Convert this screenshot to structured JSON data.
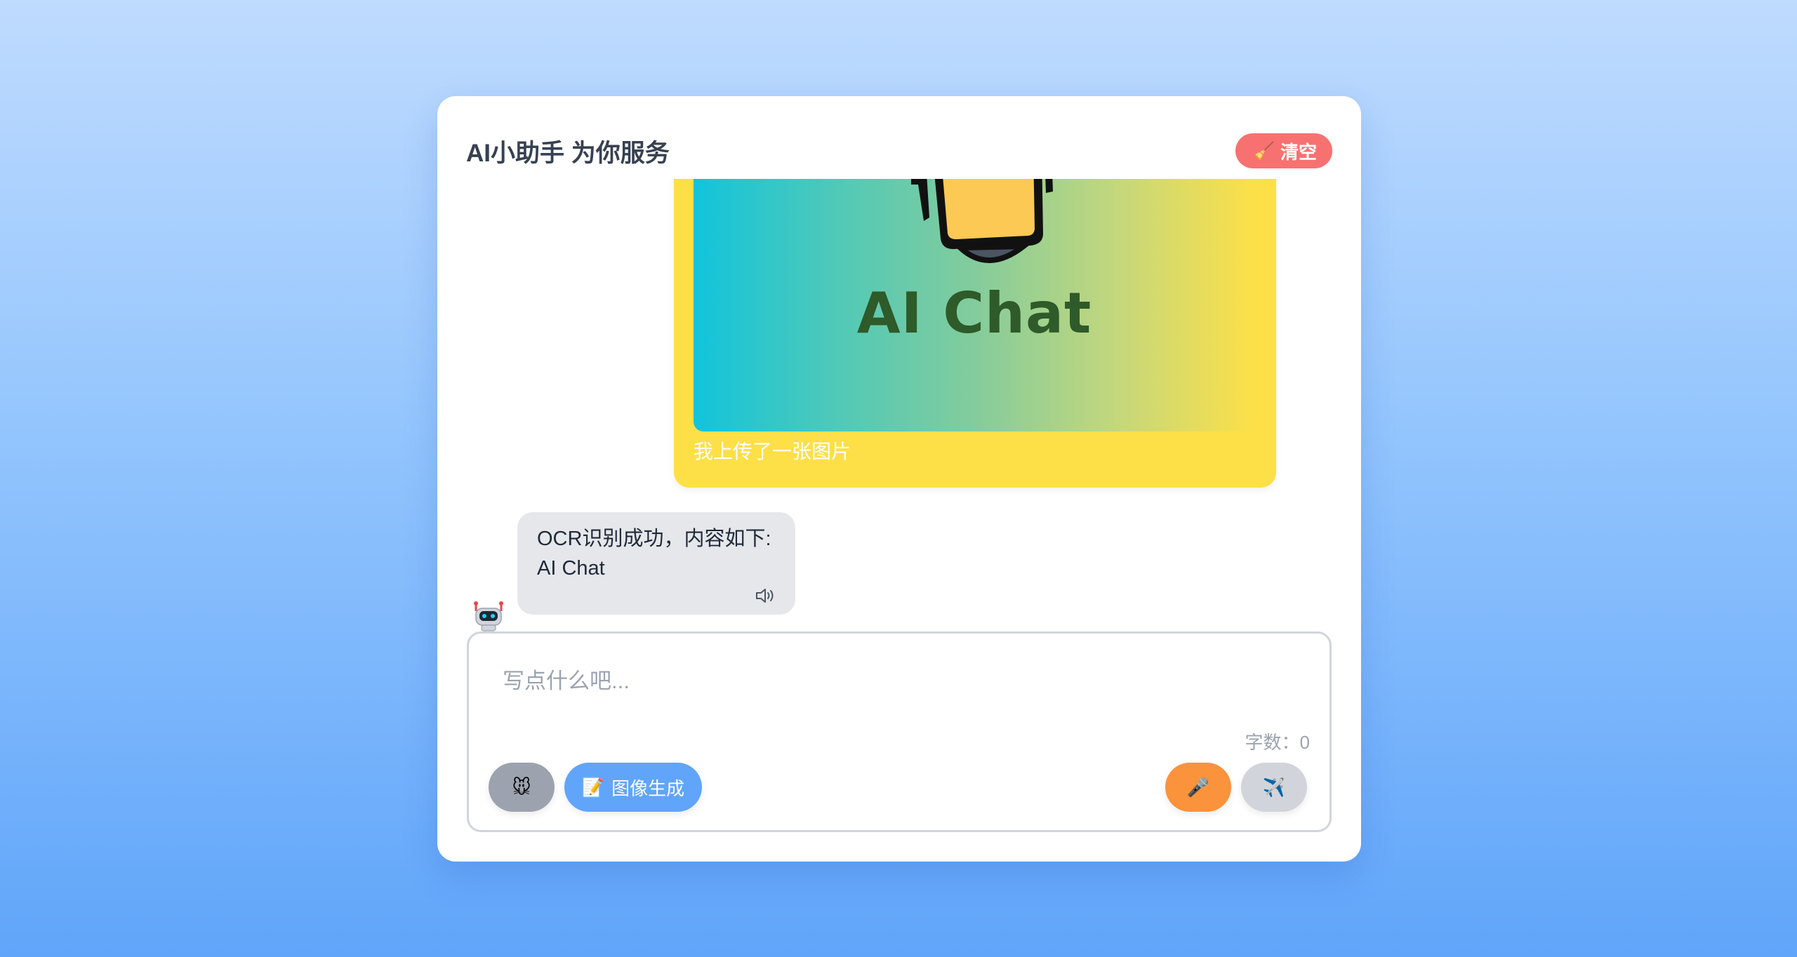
{
  "header": {
    "title": "AI小助手 为你服务",
    "clear_label": "清空",
    "clear_icon": "broom-icon"
  },
  "messages": {
    "user": {
      "image_text": "AI Chat",
      "caption": "我上传了一张图片"
    },
    "bot": {
      "line1": "OCR识别成功，内容如下:",
      "line2": "AI Chat"
    }
  },
  "input": {
    "placeholder": "写点什么吧...",
    "word_count": "字数：0"
  },
  "toolbar": {
    "emoji_icon": "emoji-icon",
    "image_gen_label": "图像生成",
    "image_gen_icon": "memo-icon",
    "mic_icon": "microphone-icon",
    "send_icon": "airplane-icon"
  },
  "colors": {
    "clear": "#f87171",
    "user_bubble": "#fde047",
    "bot_bubble": "#e5e7eb",
    "image_gen": "#60a5fa",
    "mic": "#fb923c",
    "send": "#d1d5db"
  }
}
